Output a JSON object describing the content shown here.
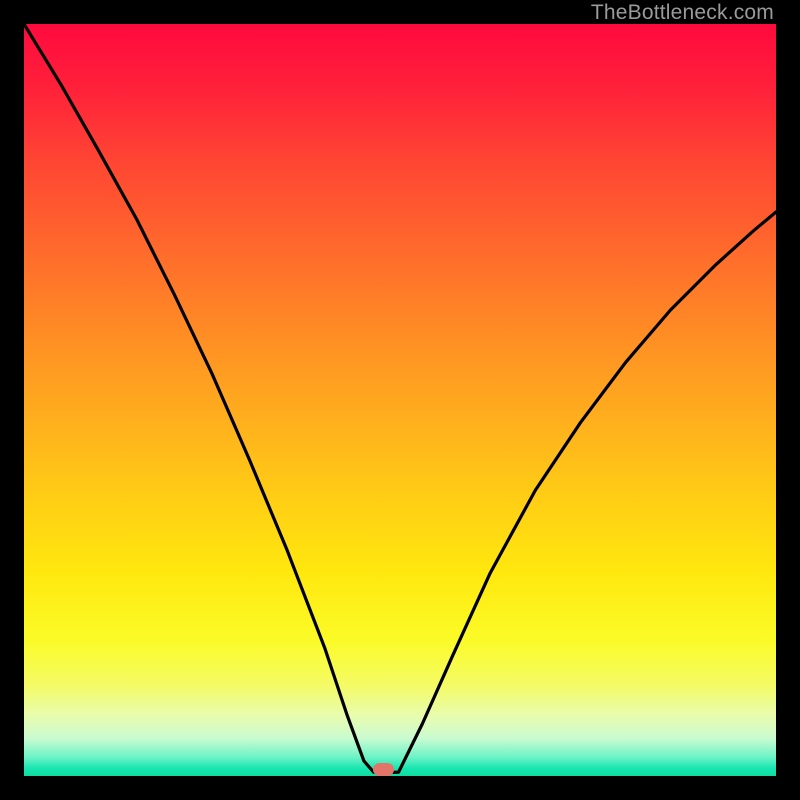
{
  "watermark": "TheBottleneck.com",
  "marker": {
    "cx_frac": 0.478,
    "cy_frac": 0.991
  },
  "chart_data": {
    "type": "line",
    "title": "",
    "xlabel": "",
    "ylabel": "",
    "xlim": [
      0,
      1
    ],
    "ylim": [
      0,
      1
    ],
    "series": [
      {
        "name": "left-branch",
        "x": [
          0.0,
          0.05,
          0.1,
          0.15,
          0.2,
          0.25,
          0.3,
          0.35,
          0.4,
          0.43,
          0.452,
          0.465
        ],
        "y": [
          1.0,
          0.918,
          0.83,
          0.74,
          0.64,
          0.535,
          0.42,
          0.3,
          0.17,
          0.08,
          0.02,
          0.005
        ]
      },
      {
        "name": "flat-bottom",
        "x": [
          0.465,
          0.498
        ],
        "y": [
          0.005,
          0.005
        ]
      },
      {
        "name": "right-branch",
        "x": [
          0.498,
          0.53,
          0.57,
          0.62,
          0.68,
          0.74,
          0.8,
          0.86,
          0.92,
          0.97,
          1.0
        ],
        "y": [
          0.005,
          0.07,
          0.16,
          0.27,
          0.38,
          0.47,
          0.55,
          0.62,
          0.68,
          0.725,
          0.75
        ]
      }
    ],
    "annotations": [
      {
        "type": "marker",
        "x": 0.478,
        "y": 0.009,
        "color": "#e2746a"
      }
    ]
  }
}
